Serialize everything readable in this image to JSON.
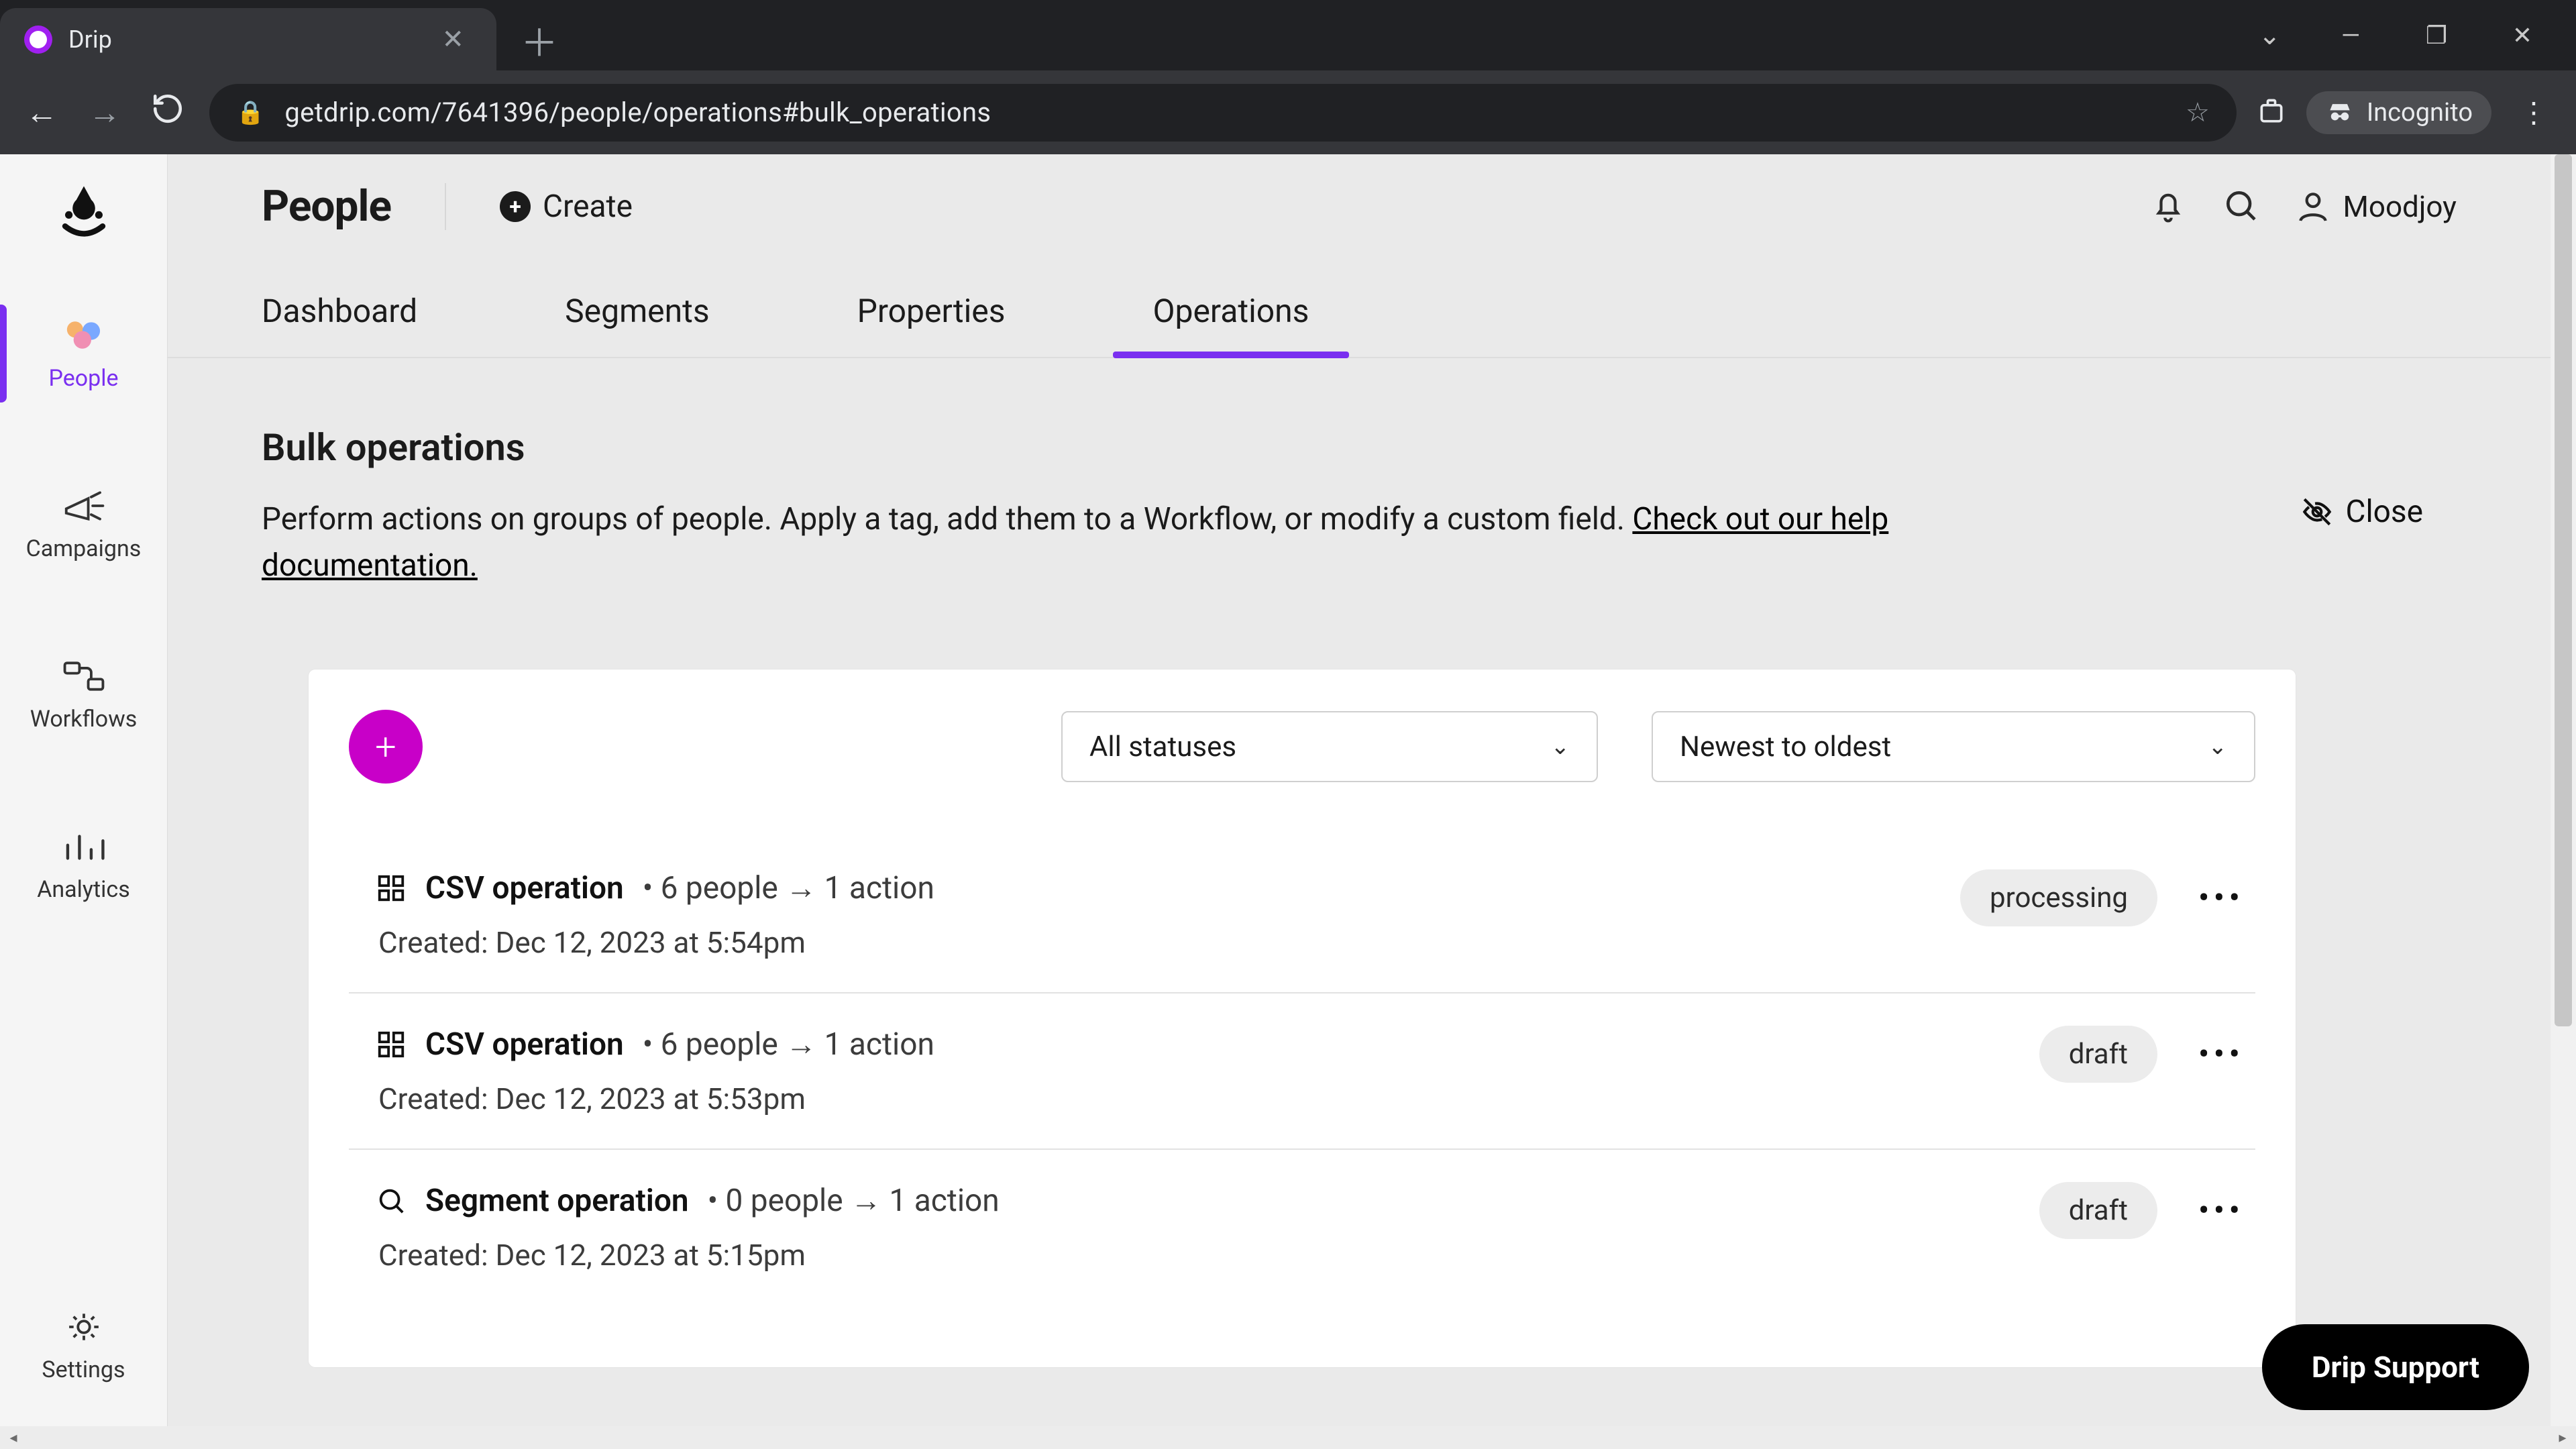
{
  "browser": {
    "tab_title": "Drip",
    "url": "getdrip.com/7641396/people/operations#bulk_operations",
    "incognito_label": "Incognito"
  },
  "sidebar": {
    "items": [
      {
        "label": "People"
      },
      {
        "label": "Campaigns"
      },
      {
        "label": "Workflows"
      },
      {
        "label": "Analytics"
      }
    ],
    "settings_label": "Settings"
  },
  "header": {
    "title": "People",
    "create_label": "Create",
    "user_name": "Moodjoy"
  },
  "tabs": {
    "items": [
      {
        "label": "Dashboard"
      },
      {
        "label": "Segments"
      },
      {
        "label": "Properties"
      },
      {
        "label": "Operations"
      }
    ],
    "active_index": 3
  },
  "section": {
    "title": "Bulk operations",
    "desc_prefix": "Perform actions on groups of people. Apply a tag, add them to a Workflow, or modify a custom field. ",
    "help_link_text": "Check out our help documentation.",
    "close_label": "Close"
  },
  "filters": {
    "status_selected": "All statuses",
    "sort_selected": "Newest to oldest"
  },
  "operations": [
    {
      "icon": "grid",
      "name": "CSV operation",
      "meta": "• 6 people → 1 action",
      "created": "Created: Dec 12, 2023 at 5:54pm",
      "status": "processing"
    },
    {
      "icon": "grid",
      "name": "CSV operation",
      "meta": "• 6 people → 1 action",
      "created": "Created: Dec 12, 2023 at 5:53pm",
      "status": "draft"
    },
    {
      "icon": "search",
      "name": "Segment operation",
      "meta": "• 0 people → 1 action",
      "created": "Created: Dec 12, 2023 at 5:15pm",
      "status": "draft"
    }
  ],
  "support_label": "Drip Support"
}
